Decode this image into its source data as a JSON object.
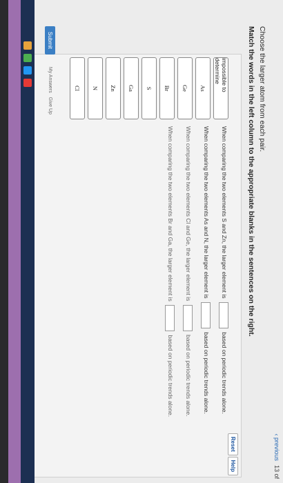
{
  "header": {
    "previous": "‹ previous",
    "page_counter": "13 of"
  },
  "instructions": {
    "line1": "Choose the larger atom from each pair.",
    "line2": "Match the words in the left column to the appropriate blanks in the sentences on the right."
  },
  "toolbar": {
    "reset": "Reset",
    "help": "Help"
  },
  "words": [
    "impossible to determine",
    "As",
    "Ge",
    "Br",
    "S",
    "Ga",
    "Zn",
    "N",
    "Cl"
  ],
  "sentences": [
    {
      "before": "When comparing the two elements S and Zn, the larger element is",
      "after": "based on periodic trends alone."
    },
    {
      "before": "When comparing the two elements As and N, the larger element is",
      "after": "based on periodic trends alone."
    },
    {
      "before": "When comparing the two elements Cl and Ge, the larger element is",
      "after": "based on periodic trends alone."
    },
    {
      "before": "When comparing the two elements Br and Ga, the larger element is",
      "after": "based on periodic trends alone."
    }
  ],
  "footer": {
    "submit": "Submit",
    "my_answers": "My Answers",
    "give_up": "Give Up"
  },
  "colors": {
    "link": "#1e56a0",
    "submit_bg": "#3b7fc4",
    "sidebar": "#9d6fae",
    "taskbar": "#1c2f52"
  }
}
